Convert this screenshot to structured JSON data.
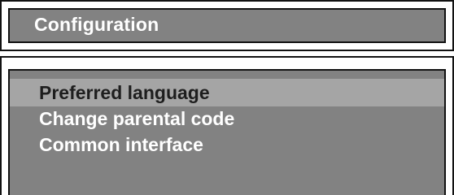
{
  "header": {
    "title": "Configuration"
  },
  "menu": {
    "selected_index": 0,
    "items": [
      {
        "label": "Preferred language",
        "selected": true
      },
      {
        "label": "Change parental code",
        "selected": false
      },
      {
        "label": "Common interface",
        "selected": false
      }
    ]
  },
  "colors": {
    "panel_gray": "#828282",
    "highlight_gray": "#a5a5a5",
    "border": "#111111",
    "text_light": "#ffffff",
    "text_dark": "#1e1e1e"
  }
}
